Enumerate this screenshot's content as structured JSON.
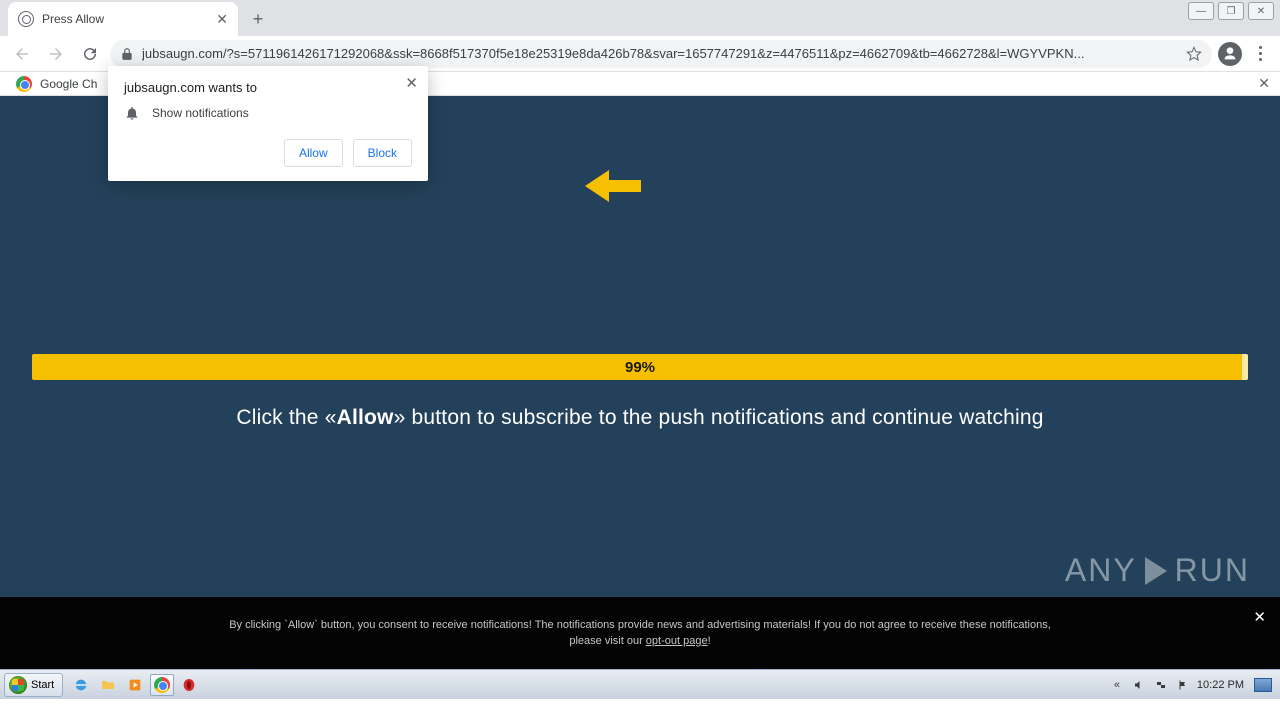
{
  "browser": {
    "tab_title": "Press Allow",
    "new_tab_plus": "+",
    "url": "jubsaugn.com/?s=5711961426171292068&ssk=8668f517370f5e18e25319e8da426b78&svar=1657747291&z=4476511&pz=4662709&tb=4662728&l=WGYVPKN...",
    "window_min": "—",
    "window_max": "❐",
    "window_close": "✕"
  },
  "bookmarks": {
    "item0": "Google Ch",
    "close": "✕"
  },
  "notif": {
    "host_wants": "jubsaugn.com wants to",
    "show_notifications": "Show notifications",
    "allow": "Allow",
    "block": "Block",
    "close": "✕"
  },
  "page": {
    "progress_label": "99%",
    "instruction_pre": "Click the «",
    "instruction_bold": "Allow",
    "instruction_post": "» button to subscribe to the push notifications and continue watching"
  },
  "consent": {
    "line1": "By clicking `Allow` button, you consent to receive notifications! The notifications provide news and advertising materials! If you do not agree to receive these notifications,",
    "line2_pre": "please visit our ",
    "optout": "opt-out page",
    "line2_post": "!",
    "close": "✕"
  },
  "watermark": {
    "brand1": "ANY",
    "brand2": "RUN"
  },
  "taskbar": {
    "start": "Start",
    "clock": "10:22 PM"
  }
}
